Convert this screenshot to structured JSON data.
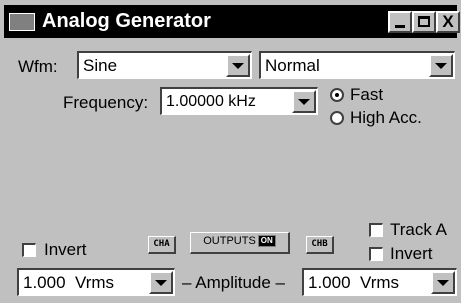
{
  "window": {
    "title": "Analog Generator",
    "controls": {
      "minimize": "_",
      "maximize": "□",
      "close": "X"
    }
  },
  "waveform": {
    "label": "Wfm:",
    "type_value": "Sine",
    "mode_value": "Normal"
  },
  "frequency": {
    "label": "Frequency:",
    "value": "1.00000 kHz",
    "options": [
      {
        "label": "Fast",
        "selected": true
      },
      {
        "label": "High Acc.",
        "selected": false
      }
    ]
  },
  "channel_a": {
    "invert_label": "Invert",
    "invert_checked": false,
    "button_label": "CHA"
  },
  "outputs": {
    "label": "OUTPUTS",
    "state": "ON"
  },
  "channel_b": {
    "button_label": "CHB",
    "track_label": "Track A",
    "track_checked": false,
    "invert_label": "Invert",
    "invert_checked": false
  },
  "amplitude": {
    "label": "– Amplitude –",
    "a_value": "1.000",
    "a_unit": "Vrms",
    "b_value": "1.000",
    "b_unit": "Vrms"
  }
}
